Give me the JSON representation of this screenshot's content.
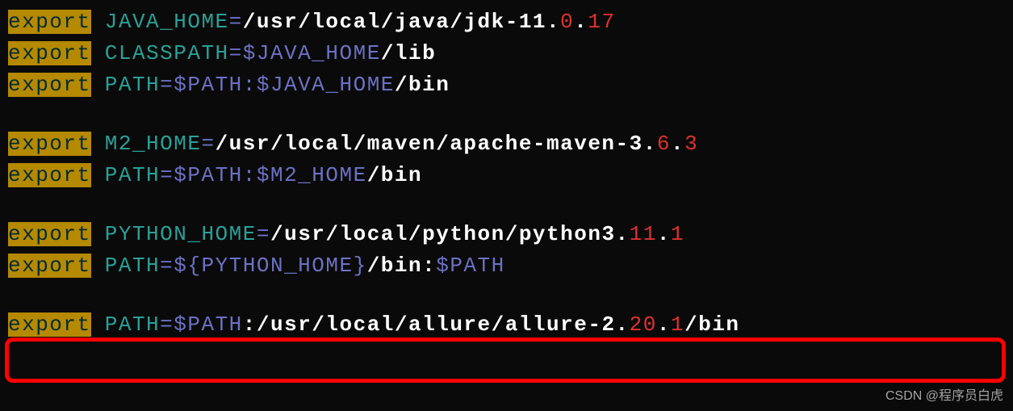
{
  "terminal": {
    "lines": [
      {
        "tokens": [
          {
            "cls": "kw-export",
            "key": "export"
          },
          {
            "cls": "dim",
            "key": "sp"
          },
          {
            "cls": "teal",
            "key": "java_home_var"
          },
          {
            "cls": "purple",
            "key": "eq"
          },
          {
            "cls": "white",
            "key": "java_path_prefix"
          },
          {
            "cls": "red",
            "key": "java_v0"
          },
          {
            "cls": "white",
            "key": "dot"
          },
          {
            "cls": "red",
            "key": "java_v17"
          }
        ]
      },
      {
        "tokens": [
          {
            "cls": "kw-export",
            "key": "export"
          },
          {
            "cls": "dim",
            "key": "sp"
          },
          {
            "cls": "teal",
            "key": "classpath_var"
          },
          {
            "cls": "purple",
            "key": "eq_dollar_javahome"
          },
          {
            "cls": "white",
            "key": "slash_lib"
          }
        ]
      },
      {
        "tokens": [
          {
            "cls": "kw-export",
            "key": "export"
          },
          {
            "cls": "dim",
            "key": "sp"
          },
          {
            "cls": "teal",
            "key": "path_var"
          },
          {
            "cls": "purple",
            "key": "eq_path_javahome"
          },
          {
            "cls": "white",
            "key": "slash_bin"
          }
        ]
      },
      {
        "gap": true
      },
      {
        "tokens": [
          {
            "cls": "kw-export",
            "key": "export"
          },
          {
            "cls": "dim",
            "key": "sp"
          },
          {
            "cls": "teal",
            "key": "m2_home_var"
          },
          {
            "cls": "purple",
            "key": "eq"
          },
          {
            "cls": "white",
            "key": "m2_path_prefix"
          },
          {
            "cls": "red",
            "key": "m2_v6"
          },
          {
            "cls": "white",
            "key": "dot"
          },
          {
            "cls": "red",
            "key": "m2_v3"
          }
        ]
      },
      {
        "tokens": [
          {
            "cls": "kw-export",
            "key": "export"
          },
          {
            "cls": "dim",
            "key": "sp"
          },
          {
            "cls": "teal",
            "key": "path_var"
          },
          {
            "cls": "purple",
            "key": "eq_path_m2home"
          },
          {
            "cls": "white",
            "key": "slash_bin"
          }
        ]
      },
      {
        "gap": true
      },
      {
        "tokens": [
          {
            "cls": "kw-export",
            "key": "export"
          },
          {
            "cls": "dim",
            "key": "sp"
          },
          {
            "cls": "teal",
            "key": "python_home_var"
          },
          {
            "cls": "purple",
            "key": "eq"
          },
          {
            "cls": "white",
            "key": "python_path_prefix"
          },
          {
            "cls": "red",
            "key": "py_v11"
          },
          {
            "cls": "white",
            "key": "dot"
          },
          {
            "cls": "red",
            "key": "py_v1"
          }
        ]
      },
      {
        "tokens": [
          {
            "cls": "kw-export",
            "key": "export"
          },
          {
            "cls": "dim",
            "key": "sp"
          },
          {
            "cls": "teal",
            "key": "path_var"
          },
          {
            "cls": "purple",
            "key": "eq_brace_pyhome"
          },
          {
            "cls": "white",
            "key": "slash_bin_colon"
          },
          {
            "cls": "purple",
            "key": "dollar_path"
          }
        ]
      },
      {
        "gap": true
      },
      {
        "tokens": [
          {
            "cls": "kw-export",
            "key": "export"
          },
          {
            "cls": "dim",
            "key": "sp"
          },
          {
            "cls": "teal",
            "key": "path_var"
          },
          {
            "cls": "purple",
            "key": "eq_dollar_path"
          },
          {
            "cls": "white",
            "key": "allure_path_prefix"
          },
          {
            "cls": "red",
            "key": "allure_v20"
          },
          {
            "cls": "white",
            "key": "dot"
          },
          {
            "cls": "red",
            "key": "allure_v1"
          },
          {
            "cls": "white",
            "key": "slash_bin"
          }
        ]
      }
    ]
  },
  "tokens": {
    "export": "export",
    "sp": " ",
    "eq": "=",
    "dot": ".",
    "java_home_var": "JAVA_HOME",
    "java_path_prefix": "/usr/local/java/jdk-11.",
    "java_v0": "0",
    "java_v17": "17",
    "classpath_var": "CLASSPATH",
    "eq_dollar_javahome": "=$JAVA_HOME",
    "slash_lib": "/lib",
    "path_var": "PATH",
    "eq_path_javahome": "=$PATH:$JAVA_HOME",
    "slash_bin": "/bin",
    "m2_home_var": "M2_HOME",
    "m2_path_prefix": "/usr/local/maven/apache-maven-3.",
    "m2_v6": "6",
    "m2_v3": "3",
    "eq_path_m2home": "=$PATH:$M2_HOME",
    "python_home_var": "PYTHON_HOME",
    "python_path_prefix": "/usr/local/python/python3.",
    "py_v11": "11",
    "py_v1": "1",
    "eq_brace_pyhome": "=${PYTHON_HOME}",
    "slash_bin_colon": "/bin:",
    "dollar_path": "$PATH",
    "eq_dollar_path": "=$PATH",
    "allure_path_prefix": ":/usr/local/allure/allure-2.",
    "allure_v20": "20",
    "allure_v1": "1"
  },
  "watermark": "CSDN @程序员白虎"
}
